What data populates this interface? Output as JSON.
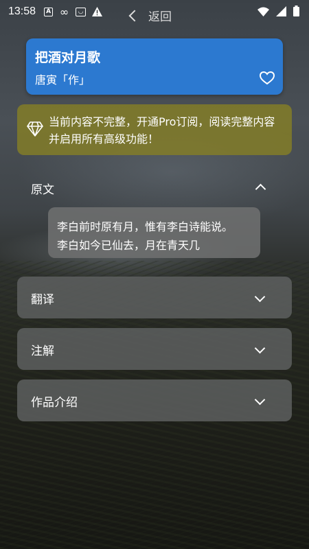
{
  "status_bar": {
    "time": "13:58",
    "left_icons": [
      "A-box-icon",
      "infinity-icon",
      "face-box-icon",
      "warning-icon"
    ],
    "right_icons": [
      "wifi-icon",
      "signal-icon",
      "battery-icon"
    ]
  },
  "nav": {
    "back_label": "返回"
  },
  "poem": {
    "title": "把酒对月歌",
    "author": "唐寅「作」",
    "favorite_icon": "heart-outline-icon"
  },
  "pro_banner": {
    "icon": "diamond-icon",
    "text": "当前内容不完整，开通Pro订阅，阅读完整内容并启用所有高级功能！"
  },
  "sections": {
    "original": {
      "label": "原文",
      "expanded": true,
      "lines": [
        "李白前时原有月，惟有李白诗能说。",
        "李白如今已仙去，月在青天几"
      ]
    },
    "translation": {
      "label": "翻译",
      "expanded": false
    },
    "notes": {
      "label": "注解",
      "expanded": false
    },
    "intro": {
      "label": "作品介绍",
      "expanded": false
    }
  },
  "colors": {
    "title_card": "#2c79d0",
    "pro_banner": "#827d28",
    "section_bg": "#5f6162"
  }
}
